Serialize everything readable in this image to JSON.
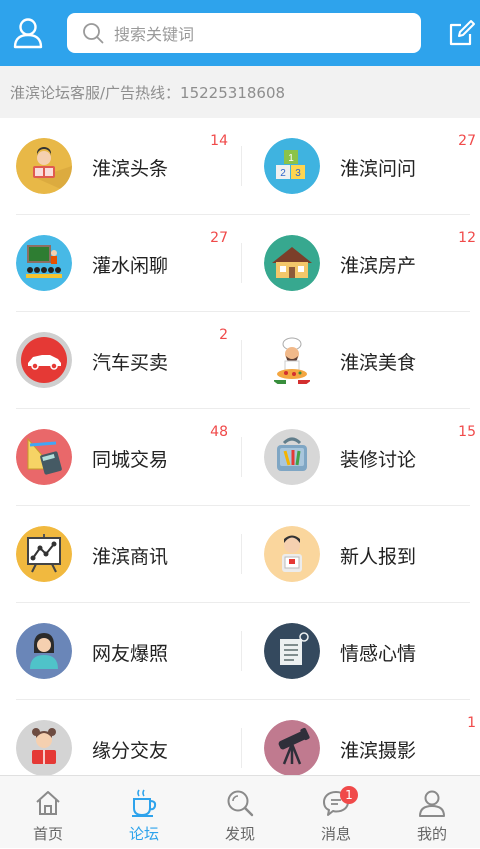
{
  "header": {
    "search_placeholder": "搜索关键词"
  },
  "notice": {
    "text": "淮滨论坛客服/广告热线：15225318608"
  },
  "forums": [
    {
      "label": "淮滨头条",
      "count": "14",
      "icon": "reading-person-icon",
      "color": "#e8b847"
    },
    {
      "label": "淮滨问问",
      "count": "27",
      "icon": "toy-blocks-icon",
      "color": "#3fb3e0"
    },
    {
      "label": "灌水闲聊",
      "count": "27",
      "icon": "meeting-icon",
      "color": "#47b9e6"
    },
    {
      "label": "淮滨房产",
      "count": "12",
      "icon": "house-icon",
      "color": "#37a88f"
    },
    {
      "label": "汽车买卖",
      "count": "2",
      "icon": "car-icon",
      "color": "#e53935"
    },
    {
      "label": "淮滨美食",
      "count": "",
      "icon": "chef-pizza-icon",
      "color": "#ffffff"
    },
    {
      "label": "同城交易",
      "count": "48",
      "icon": "calculator-tools-icon",
      "color": "#e9686a"
    },
    {
      "label": "装修讨论",
      "count": "15",
      "icon": "toolbag-icon",
      "color": "#d7d7d7"
    },
    {
      "label": "淮滨商讯",
      "count": "",
      "icon": "chart-board-icon",
      "color": "#f1b93f"
    },
    {
      "label": "新人报到",
      "count": "",
      "icon": "newcomer-icon",
      "color": "#fad69d"
    },
    {
      "label": "网友爆照",
      "count": "",
      "icon": "person-photo-icon",
      "color": "#6a86b8"
    },
    {
      "label": "情感心情",
      "count": "",
      "icon": "notes-icon",
      "color": "#34495e"
    },
    {
      "label": "缘分交友",
      "count": "",
      "icon": "girl-reading-icon",
      "color": "#d4d4d4"
    },
    {
      "label": "淮滨摄影",
      "count": "1",
      "icon": "telescope-icon",
      "color": "#c07a8f"
    }
  ],
  "tabs": [
    {
      "label": "首页",
      "icon": "home-icon",
      "active": false
    },
    {
      "label": "论坛",
      "icon": "coffee-cup-icon",
      "active": true
    },
    {
      "label": "发现",
      "icon": "discover-search-icon",
      "active": false
    },
    {
      "label": "消息",
      "icon": "message-icon",
      "active": false,
      "badge": "1"
    },
    {
      "label": "我的",
      "icon": "profile-icon",
      "active": false
    }
  ],
  "colors": {
    "primary": "#2ea3ec",
    "count": "#f04a4a",
    "notice_bg": "#f2f2f2"
  }
}
